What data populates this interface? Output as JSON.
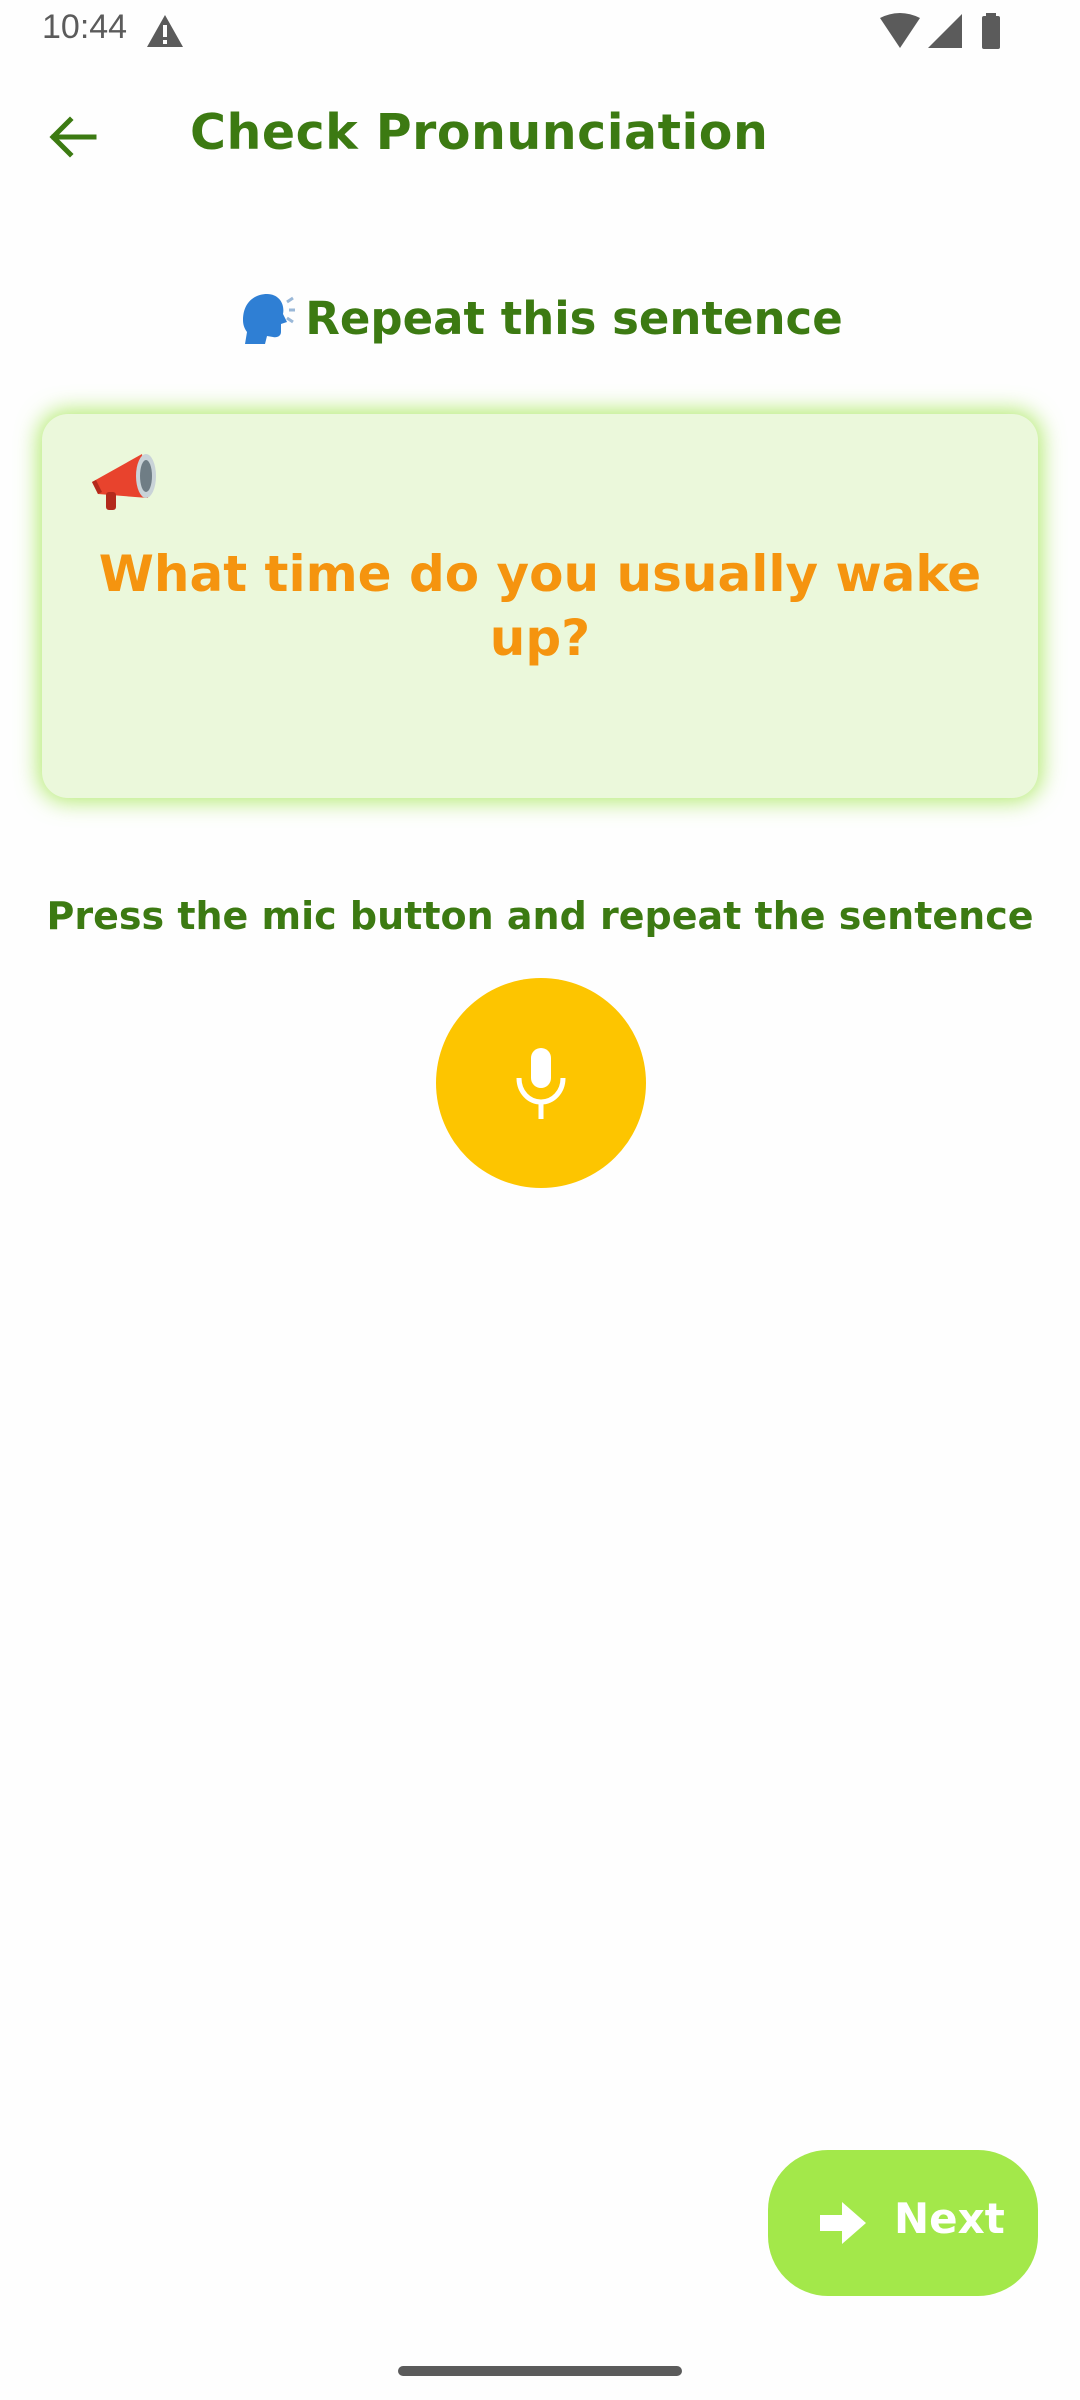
{
  "status_bar": {
    "time": "10:44",
    "icons": [
      "warning-icon",
      "wifi-icon",
      "signal-icon",
      "battery-icon"
    ]
  },
  "app_bar": {
    "back_icon": "arrow-left-icon",
    "title": "Check Pronunciation"
  },
  "prompt": {
    "icon": "speaking-head-icon",
    "label": "Repeat this sentence"
  },
  "sentence_card": {
    "icon": "megaphone-icon",
    "sentence": "What time do you usually wake up?"
  },
  "instruction": "Press the mic button and repeat the sentence",
  "mic_button": {
    "icon": "microphone-icon"
  },
  "next_button": {
    "icon": "arrow-right-icon",
    "label": "Next"
  },
  "colors": {
    "primary_green": "#3c7a12",
    "sentence_orange": "#f5940f",
    "card_background": "#ebf8db",
    "card_glow": "#9ee646",
    "mic_yellow": "#fdc500",
    "next_green": "#a3e84a"
  }
}
